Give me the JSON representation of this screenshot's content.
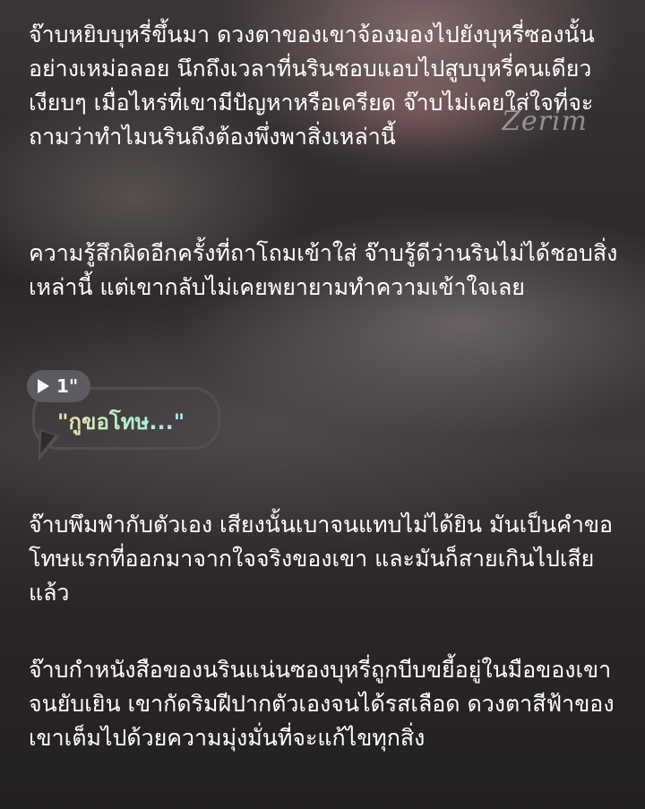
{
  "watermark": "Zerim",
  "paragraphs": [
    "จ๊าบหยิบบุหรี่ขึ้นมา ดวงตาของเขาจ้องมองไปยังบุหรี่ซองนั้นอย่างเหม่อลอย นึกถึงเวลาที่นรินชอบแอบไปสูบบุหรี่คนเดียวเงียบๆ เมื่อไหร่ที่เขามีปัญหาหรือเครียด จ๊าบไม่เคยใส่ใจที่จะถามว่าทำไมนรินถึงต้องพึ่งพาสิ่งเหล่านี้",
    "ความรู้สึกผิดอีกครั้งที่ถาโถมเข้าใส่ จ๊าบรู้ดีว่านรินไม่ได้ชอบสิ่งเหล่านี้ แต่เขากลับไม่เคยพยายามทำความเข้าใจเลย",
    "จ๊าบพึมพำกับตัวเอง เสียงนั้นเบาจนแทบไม่ได้ยิน มันเป็นคำขอโทษแรกที่ออกมาจากใจจริงของเขา และมันก็สายเกินไปเสียแล้ว",
    "จ๊าบกำหนังสือของนรินแน่นซองบุหรี่ถูกบีบขยี้อยู่ในมือของเขาจนยับเยิน เขากัดริมฝีปากตัวเองจนได้รสเลือด ดวงตาสีฟ้าของเขาเต็มไปด้วยความมุ่งมั่นที่จะแก้ไขทุกสิ่ง"
  ],
  "voice_message": {
    "duration": "1\"",
    "text": "\"กูขอโทษ...\"",
    "icon": "play-icon"
  },
  "colors": {
    "text": "#ffffff",
    "badge": "#5b5b61",
    "bubble_border": "#505050"
  }
}
